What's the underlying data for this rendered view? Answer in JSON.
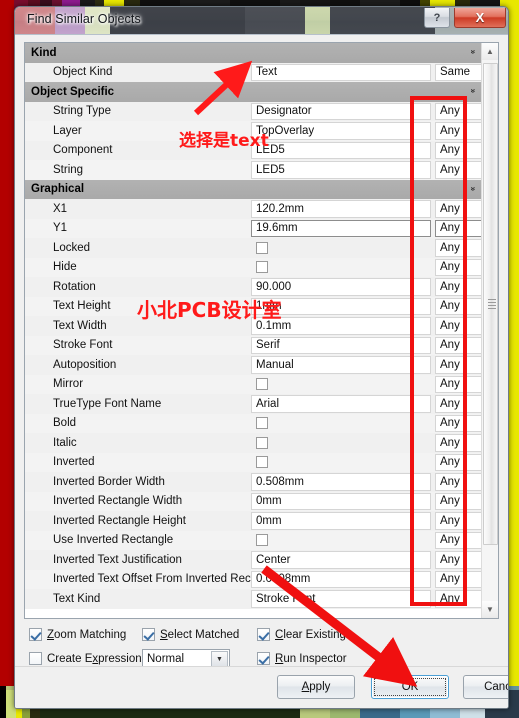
{
  "window": {
    "title": "Find Similar Objects",
    "help_button": "?",
    "close_button": "X"
  },
  "grid": {
    "group_chevron": "»",
    "rows": [
      {
        "type": "group",
        "label": "Kind"
      },
      {
        "type": "item",
        "label": "Object Kind",
        "value": "Text",
        "mode": "Same",
        "control": "text",
        "selected": false
      },
      {
        "type": "group",
        "label": "Object Specific"
      },
      {
        "type": "item",
        "label": "String Type",
        "value": "Designator",
        "mode": "Any",
        "control": "text",
        "selected": false
      },
      {
        "type": "item",
        "label": "Layer",
        "value": "TopOverlay",
        "mode": "Any",
        "control": "text",
        "selected": false
      },
      {
        "type": "item",
        "label": "Component",
        "value": "LED5",
        "mode": "Any",
        "control": "text",
        "selected": false
      },
      {
        "type": "item",
        "label": "String",
        "value": "LED5",
        "mode": "Any",
        "control": "text",
        "selected": false
      },
      {
        "type": "group",
        "label": "Graphical"
      },
      {
        "type": "item",
        "label": "X1",
        "value": "120.2mm",
        "mode": "Any",
        "control": "text",
        "selected": false
      },
      {
        "type": "item",
        "label": "Y1",
        "value": "19.6mm",
        "mode": "Any",
        "control": "text",
        "selected": true
      },
      {
        "type": "item",
        "label": "Locked",
        "value": "",
        "mode": "Any",
        "control": "checkbox",
        "checked": false
      },
      {
        "type": "item",
        "label": "Hide",
        "value": "",
        "mode": "Any",
        "control": "checkbox",
        "checked": false
      },
      {
        "type": "item",
        "label": "Rotation",
        "value": "90.000",
        "mode": "Any",
        "control": "text",
        "selected": false
      },
      {
        "type": "item",
        "label": "Text Height",
        "value": "1mm",
        "mode": "Any",
        "control": "text",
        "selected": false
      },
      {
        "type": "item",
        "label": "Text Width",
        "value": "0.1mm",
        "mode": "Any",
        "control": "text",
        "selected": false
      },
      {
        "type": "item",
        "label": "Stroke Font",
        "value": "Serif",
        "mode": "Any",
        "control": "text",
        "selected": false
      },
      {
        "type": "item",
        "label": "Autoposition",
        "value": "Manual",
        "mode": "Any",
        "control": "text",
        "selected": false
      },
      {
        "type": "item",
        "label": "Mirror",
        "value": "",
        "mode": "Any",
        "control": "checkbox",
        "checked": false
      },
      {
        "type": "item",
        "label": "TrueType Font Name",
        "value": "Arial",
        "mode": "Any",
        "control": "text",
        "selected": false
      },
      {
        "type": "item",
        "label": "Bold",
        "value": "",
        "mode": "Any",
        "control": "checkbox",
        "checked": false
      },
      {
        "type": "item",
        "label": "Italic",
        "value": "",
        "mode": "Any",
        "control": "checkbox",
        "checked": false
      },
      {
        "type": "item",
        "label": "Inverted",
        "value": "",
        "mode": "Any",
        "control": "checkbox",
        "checked": false
      },
      {
        "type": "item",
        "label": "Inverted Border Width",
        "value": "0.508mm",
        "mode": "Any",
        "control": "text",
        "selected": false
      },
      {
        "type": "item",
        "label": "Inverted Rectangle Width",
        "value": "0mm",
        "mode": "Any",
        "control": "text",
        "selected": false
      },
      {
        "type": "item",
        "label": "Inverted Rectangle Height",
        "value": "0mm",
        "mode": "Any",
        "control": "text",
        "selected": false
      },
      {
        "type": "item",
        "label": "Use Inverted Rectangle",
        "value": "",
        "mode": "Any",
        "control": "checkbox",
        "checked": false
      },
      {
        "type": "item",
        "label": "Inverted Text Justification",
        "value": "Center",
        "mode": "Any",
        "control": "text",
        "selected": false
      },
      {
        "type": "item",
        "label": "Inverted Text Offset From Inverted Rect",
        "value": "0.0508mm",
        "mode": "Any",
        "control": "text",
        "selected": false
      },
      {
        "type": "item",
        "label": "Text Kind",
        "value": "Stroke Font",
        "mode": "Any",
        "control": "text",
        "selected": false
      }
    ]
  },
  "options": {
    "zoom_matching": {
      "label": "Zoom Matching",
      "accel": "Z",
      "checked": true
    },
    "select_matched": {
      "label": "Select Matched",
      "accel": "S",
      "checked": true
    },
    "clear_existing": {
      "label": "Clear Existing",
      "accel": "C",
      "checked": true
    },
    "create_expression": {
      "label": "Create Expression",
      "accel": "x",
      "checked": false
    },
    "run_inspector": {
      "label": "Run Inspector",
      "accel": "R",
      "checked": true
    },
    "mode_select": {
      "value": "Normal",
      "arrow": "▼"
    }
  },
  "footer": {
    "apply": "Apply",
    "ok": "OK",
    "cancel": "Cancel"
  },
  "annotations": {
    "text_hint": "选择是text",
    "watermark": "小北PCB设计室",
    "accent_color": "#ff1a1a"
  },
  "scrollbar": {
    "up_arrow": "▲",
    "down_arrow": "▼"
  }
}
